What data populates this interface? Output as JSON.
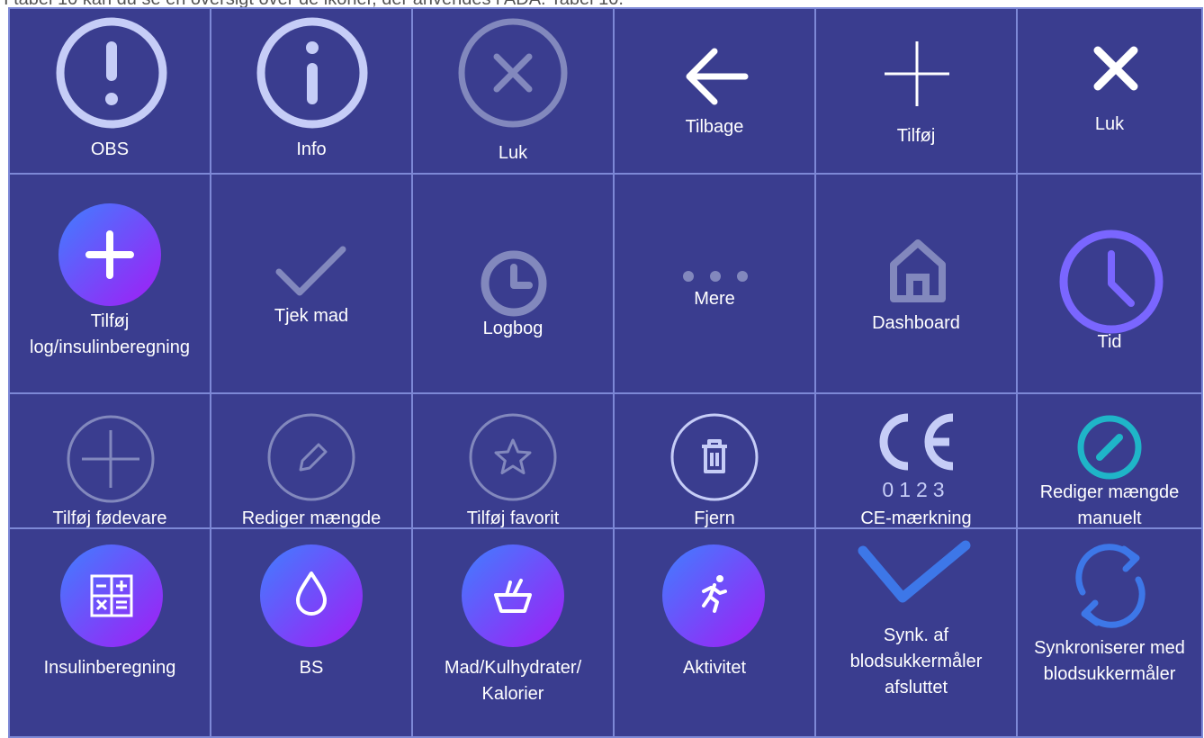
{
  "intro_text": "I tabel 10 kan du se en oversigt over de ikoner, der anvendes i ADA. Tabel 10.",
  "cells": [
    {
      "label": "OBS",
      "icon": "exclamation-circle-icon"
    },
    {
      "label": "Info",
      "icon": "info-circle-icon"
    },
    {
      "label": "Luk",
      "icon": "close-circle-icon"
    },
    {
      "label": "Tilbage",
      "icon": "arrow-left-icon"
    },
    {
      "label": "Tilføj",
      "icon": "plus-icon"
    },
    {
      "label": "Luk",
      "icon": "close-x-icon"
    },
    {
      "label": "Tilføj log/insulinberegning",
      "icon": "gradient-plus-icon"
    },
    {
      "label": "Tjek mad",
      "icon": "checkmark-icon"
    },
    {
      "label": "Logbog",
      "icon": "clock-small-icon"
    },
    {
      "label": "Mere",
      "icon": "more-dots-icon"
    },
    {
      "label": "Dashboard",
      "icon": "home-icon"
    },
    {
      "label": "Tid",
      "icon": "clock-large-icon"
    },
    {
      "label": "Tilføj fødevare",
      "icon": "add-food-circle-icon"
    },
    {
      "label": "Rediger mængde",
      "icon": "pencil-circle-icon"
    },
    {
      "label": "Tilføj favorit",
      "icon": "star-circle-icon"
    },
    {
      "label": "Fjern",
      "icon": "trash-circle-icon"
    },
    {
      "label": "CE-mærkning",
      "icon": "ce-mark-icon",
      "ce_number": "0123"
    },
    {
      "label": "Rediger mængde manuelt",
      "icon": "edit-manual-icon"
    },
    {
      "label": "Insulinberegning",
      "icon": "calculator-icon"
    },
    {
      "label": "BS",
      "icon": "drop-icon"
    },
    {
      "label": "Mad/Kulhydrater/ Kalorier",
      "icon": "food-bowl-icon"
    },
    {
      "label": "Aktivitet",
      "icon": "runner-icon"
    },
    {
      "label": "Synk. af blodsukkermåler afsluttet",
      "icon": "sync-done-check-icon"
    },
    {
      "label": "Synkroniserer med blodsukkermåler",
      "icon": "sync-arrows-icon"
    }
  ],
  "colors": {
    "background": "#3a3d8f",
    "grid_lines": "#7d88d6",
    "gradient_start": "#3f7fff",
    "gradient_end": "#a21cf5",
    "teal": "#1fb5c8",
    "purple": "#7a66ff"
  }
}
